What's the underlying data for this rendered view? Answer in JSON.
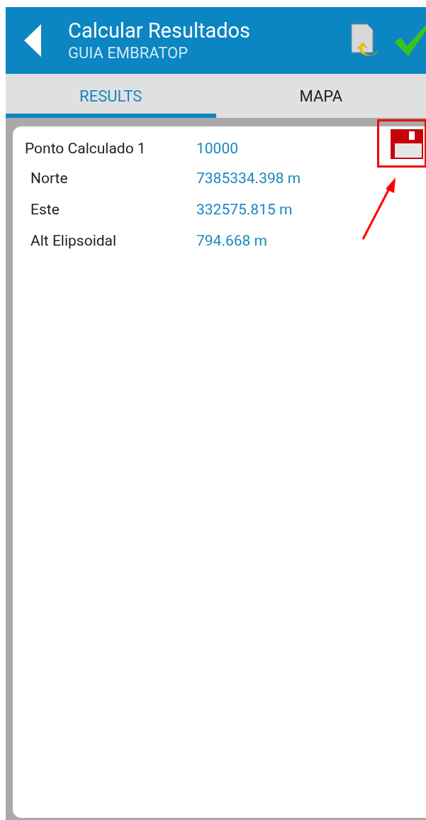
{
  "header": {
    "title": "Calcular Resultados",
    "subtitle": "GUIA EMBRATOP"
  },
  "tabs": [
    {
      "label": "RESULTS",
      "selected": true
    },
    {
      "label": "MAPA",
      "selected": false
    }
  ],
  "point": {
    "label": "Ponto Calculado 1",
    "value": "10000"
  },
  "rows": [
    {
      "label": "Norte",
      "value": "7385334.398 m"
    },
    {
      "label": "Este",
      "value": "332575.815 m"
    },
    {
      "label": "Alt Elipsoidal",
      "value": "794.668 m"
    }
  ]
}
